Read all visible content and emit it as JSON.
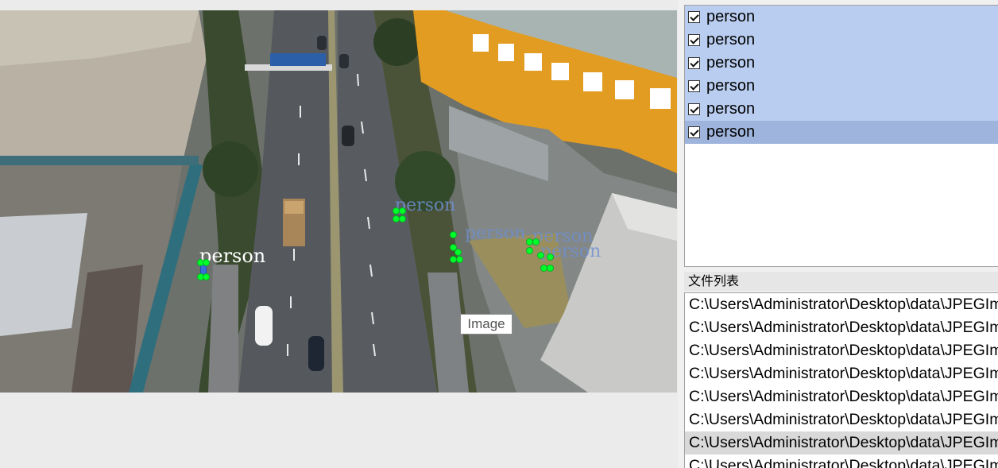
{
  "canvas": {
    "tooltip": "Image",
    "overlay_labels": [
      {
        "text": "person"
      },
      {
        "text": "person"
      },
      {
        "text": "person"
      },
      {
        "text": "person"
      },
      {
        "text": "person"
      }
    ]
  },
  "label_list": {
    "items": [
      {
        "label": "person",
        "checked": true
      },
      {
        "label": "person",
        "checked": true
      },
      {
        "label": "person",
        "checked": true
      },
      {
        "label": "person",
        "checked": true
      },
      {
        "label": "person",
        "checked": true
      },
      {
        "label": "person",
        "checked": true
      }
    ]
  },
  "file_list": {
    "title": "文件列表",
    "items": [
      "C:\\Users\\Administrator\\Desktop\\data\\JPEGImages",
      "C:\\Users\\Administrator\\Desktop\\data\\JPEGImages",
      "C:\\Users\\Administrator\\Desktop\\data\\JPEGImages",
      "C:\\Users\\Administrator\\Desktop\\data\\JPEGImages",
      "C:\\Users\\Administrator\\Desktop\\data\\JPEGImages",
      "C:\\Users\\Administrator\\Desktop\\data\\JPEGImages",
      "C:\\Users\\Administrator\\Desktop\\data\\JPEGImages",
      "C:\\Users\\Administrator\\Desktop\\data\\JPEGImages"
    ]
  },
  "colors": {
    "point": "#00ff2a",
    "selected_label": "#b9cdf0",
    "current_label": "#9eb4dc"
  }
}
